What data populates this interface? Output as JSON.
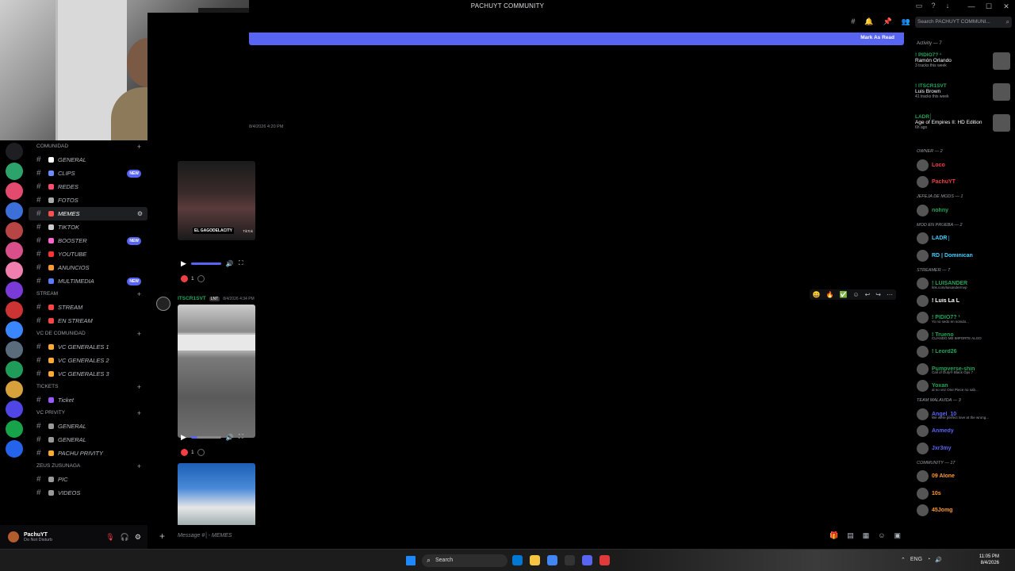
{
  "window": {
    "title": "PACHUYT COMMUNITY",
    "controls": [
      "—",
      "☐",
      "✕"
    ]
  },
  "channels": {
    "categories": [
      {
        "name": "COMUNIDAD",
        "items": [
          {
            "label": "GENERAL",
            "color": "#ffffff",
            "new": false
          },
          {
            "label": "CLIPS",
            "color": "#6b8cff",
            "new": true
          },
          {
            "label": "REDES",
            "color": "#ff4d6d",
            "new": false
          },
          {
            "label": "FOTOS",
            "color": "#aaaaaa",
            "new": false
          },
          {
            "label": "MEMES",
            "color": "#ff5050",
            "new": false,
            "active": true
          },
          {
            "label": "TIKTOK",
            "color": "#cccccc",
            "new": false
          },
          {
            "label": "BOOSTER",
            "color": "#ff66cc",
            "new": true
          },
          {
            "label": "YOUTUBE",
            "color": "#ff3333",
            "new": false
          },
          {
            "label": "ANUNCIOS",
            "color": "#ff9933",
            "new": false
          },
          {
            "label": "MULTIMEDIA",
            "color": "#5c7cfa",
            "new": true
          }
        ]
      },
      {
        "name": "STREAM",
        "items": [
          {
            "label": "STREAM",
            "color": "#ff4444",
            "new": false
          },
          {
            "label": "EN STREAM",
            "color": "#ff4444",
            "new": false
          }
        ]
      },
      {
        "name": "VC DE COMUNIDAD",
        "items": [
          {
            "label": "VC GENERALES 1",
            "color": "#ffaa33",
            "new": false
          },
          {
            "label": "VC GENERALES 2",
            "color": "#ffaa33",
            "new": false
          },
          {
            "label": "VC GENERALES 3",
            "color": "#ffaa33",
            "new": false
          }
        ]
      },
      {
        "name": "TICKETS",
        "items": [
          {
            "label": "Ticket",
            "color": "#9b59ff",
            "new": false
          }
        ]
      },
      {
        "name": "VC PRIVITY",
        "items": [
          {
            "label": "GENERAL",
            "color": "#999999",
            "new": false
          },
          {
            "label": "GENERAL",
            "color": "#999999",
            "new": false
          },
          {
            "label": "PACHU PRIVITY",
            "color": "#ffaa33",
            "new": false
          }
        ]
      },
      {
        "name": "ZEUS ZUSUNAGA",
        "items": [
          {
            "label": "PIC",
            "color": "#999999",
            "new": false
          },
          {
            "label": "VIDEOS",
            "color": "#999999",
            "new": false
          }
        ]
      }
    ],
    "new_badge": "NEW"
  },
  "user": {
    "name": "PachuYT",
    "status": "Do Not Disturb"
  },
  "chat": {
    "mark_as_read": "Mark As Read",
    "timestamp_top": "8/4/2026 4:20 PM",
    "reaction1_count": "1",
    "reaction2_count": "1",
    "video_caption": "EL GAGODELACITY",
    "video_watermark": "TikTok",
    "message": {
      "author": "ITSCR1SVT",
      "tag": "LNT",
      "time": "8/4/2026 4:34 PM"
    },
    "composer_placeholder": "Message #│-  MEMES"
  },
  "members": {
    "search_placeholder": "Search PACHUYT COMMUNI...",
    "activity_header": "Activity — 7",
    "activities": [
      {
        "name": "! PIDIO7? ¹",
        "detail": "Ramón Orlando",
        "sub": "3 tracks this week"
      },
      {
        "name": "! ITSCR1SVT",
        "detail": "Luis Brown",
        "sub": "41 tracks this week"
      },
      {
        "name": "LADR│",
        "detail": "Age of Empires II: HD Edition",
        "sub": "6h ago"
      }
    ],
    "groups": [
      {
        "name": "Owner — 2",
        "members": [
          {
            "name": "Loco",
            "color": "#f23f43",
            "status": ""
          },
          {
            "name": "PachuYT",
            "color": "#f23f43",
            "status": ""
          }
        ]
      },
      {
        "name": "JEFEJA DE MODS — 1",
        "members": [
          {
            "name": "nohny",
            "color": "#23a559",
            "status": ""
          }
        ]
      },
      {
        "name": "MOD EN PRUEBA — 2",
        "members": [
          {
            "name": "LADR│",
            "color": "#3ecfff",
            "status": ""
          },
          {
            "name": "RD | Dominican",
            "color": "#3ecfff",
            "status": ""
          }
        ]
      },
      {
        "name": "STREAMER — 7",
        "members": [
          {
            "name": "! LUISANDER",
            "color": "#23a559",
            "status": "link.com/luisandermvp"
          },
          {
            "name": "! Luis La L",
            "color": "#ffffff",
            "status": ""
          },
          {
            "name": "! PIDIO7? ¹",
            "color": "#23a559",
            "status": "Yo no sedo en sonido..."
          },
          {
            "name": "! Trueno",
            "color": "#23a559",
            "status": "CUANDO ME IMPORTE ALGO"
          },
          {
            "name": "! Leord26",
            "color": "#23a559",
            "status": ""
          },
          {
            "name": "Pumpverse-shin",
            "color": "#23a559",
            "status": "Call of Duty® Black Ops 7"
          },
          {
            "name": "Yoxan",
            "color": "#23a559",
            "status": "al no vez One Piece no sab..."
          }
        ]
      },
      {
        "name": "TEAM MALAVIDA — 3",
        "members": [
          {
            "name": "Ángel_10",
            "color": "#5865f2",
            "status": "We were perfect love at the wrong..."
          },
          {
            "name": "Anmedy",
            "color": "#5865f2",
            "status": ""
          },
          {
            "name": "Jxr3my",
            "color": "#5865f2",
            "status": ""
          }
        ]
      },
      {
        "name": "COMMUNITY — 17",
        "members": [
          {
            "name": "09 Alone",
            "color": "#ff9933",
            "status": ""
          },
          {
            "name": "10s",
            "color": "#ff9933",
            "status": ""
          },
          {
            "name": "45Jomg",
            "color": "#ff9933",
            "status": ""
          }
        ]
      }
    ]
  },
  "taskbar": {
    "search_label": "Search",
    "lang": "ENG",
    "time": "11:05 PM",
    "date": "8/4/2026"
  }
}
